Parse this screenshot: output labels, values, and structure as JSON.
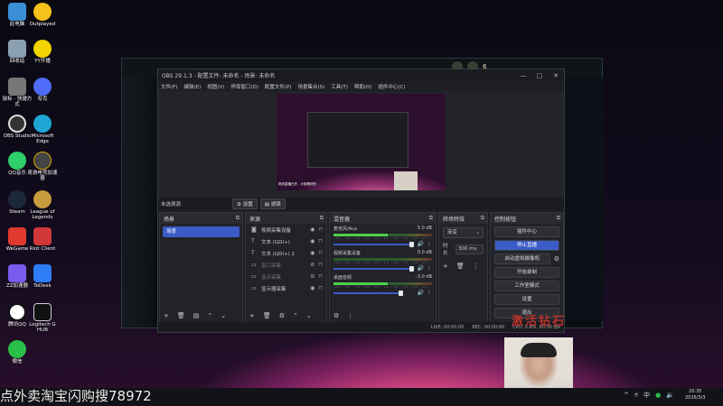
{
  "desktop": {
    "icons": [
      {
        "label": "此电脑",
        "color": "#3a8fd6"
      },
      {
        "label": "Outplayed",
        "color": "#f4c21a"
      },
      {
        "label": "回收站",
        "color": "#8aa0b0"
      },
      {
        "label": "YY开播",
        "color": "#f2d400"
      },
      {
        "label": "鼠标 · 快捷方式",
        "color": "#777777"
      },
      {
        "label": "夸克",
        "color": "#4d6cf7"
      },
      {
        "label": "OBS Studio",
        "color": "#333333"
      },
      {
        "label": "Microsoft Edge",
        "color": "#1fa5d4"
      },
      {
        "label": "QQ音乐",
        "color": "#2fcf6c"
      },
      {
        "label": "奇游电竞加速器",
        "color": "#444444"
      },
      {
        "label": "Steam",
        "color": "#1b2838"
      },
      {
        "label": "League of Legends",
        "color": "#c89b3c"
      },
      {
        "label": "WeGame",
        "color": "#e03a2e"
      },
      {
        "label": "Riot Client",
        "color": "#d13639"
      },
      {
        "label": "ZZ加速器",
        "color": "#7a5cf0"
      },
      {
        "label": "ToDesk",
        "color": "#2f7df6"
      },
      {
        "label": "腾讯QQ",
        "color": "#ffffff"
      },
      {
        "label": "Logitech G HUB",
        "color": "#111111"
      },
      {
        "label": "微信",
        "color": "#2bc04a"
      }
    ]
  },
  "obs": {
    "title": "OBS 29.1.3 - 配置文件: 未命名 - 场景: 未命名",
    "window_controls": [
      "—",
      "□",
      "✕"
    ],
    "menu": [
      "文件(F)",
      "编辑(E)",
      "视图(V)",
      "停靠窗口(D)",
      "配置文件(P)",
      "场景集合(S)",
      "工具(T)",
      "帮助(H)",
      "插件中心(C)"
    ],
    "preview_label": "未选择源",
    "preview_buttons": [
      "⚙ 设置",
      "▤ 滤镜"
    ],
    "canvas_caption": "网页直播已开，大家看好的",
    "scenes": {
      "title": "场景",
      "items": [
        "场景"
      ]
    },
    "sources": {
      "title": "来源",
      "items": [
        {
          "name": "视频采集设备",
          "icon": "📷",
          "dim": false
        },
        {
          "name": "文本 (GDI+)",
          "icon": "T",
          "dim": false
        },
        {
          "name": "文本 (GDI+) 2",
          "icon": "T",
          "dim": false
        },
        {
          "name": "窗口采集",
          "icon": "▭",
          "dim": true
        },
        {
          "name": "显示采集",
          "icon": "▭",
          "dim": true
        },
        {
          "name": "显示器采集",
          "icon": "▭",
          "dim": false
        }
      ]
    },
    "mixer": {
      "title": "混音器",
      "channels": [
        {
          "name": "麦克风/Aux",
          "db": "5.0 dB",
          "active": true
        },
        {
          "name": "视频采集设备",
          "db": "0.0 dB",
          "active": false
        },
        {
          "name": "桌面音频",
          "db": "-3.0 dB",
          "active": true
        }
      ],
      "scale": "-60 -55 -50 -45 -40 -35 -30 -25 -20 -15 -10 -5 0"
    },
    "transitions": {
      "title": "转场特效",
      "type": "渐变",
      "duration_label": "时长",
      "duration": "300 ms"
    },
    "controls": {
      "title": "控制按钮",
      "buttons": [
        "插件中心",
        "停止直播",
        "启动虚拟摄像机",
        "开始录制",
        "工作室模式",
        "设置",
        "退出"
      ]
    },
    "status": {
      "live": "LIVE: 00:00:00",
      "rec": "REC: 00:00:00",
      "cpu": "CPU: 0.8%, 60.00 fps"
    },
    "accent": "#3b5cc8"
  },
  "watermark": "激活钻石",
  "taskbar": {
    "banner": "点外卖淘宝闪购搜78972",
    "ime": "中",
    "time": "20:35",
    "date": "2026/3/3"
  },
  "lol": {
    "number": "6"
  }
}
